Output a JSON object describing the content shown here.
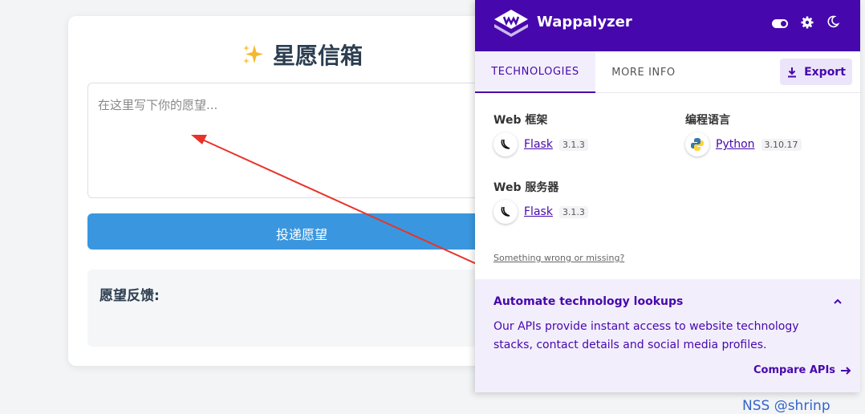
{
  "wish_page": {
    "title": "星愿信箱",
    "title_icon": "sparkles-icon",
    "textarea_placeholder": "在这里写下你的愿望...",
    "submit_label": "投递愿望",
    "feedback_title": "愿望反馈:"
  },
  "wappalyzer": {
    "brand": "Wappalyzer",
    "header_color": "#4608ad",
    "tabs": [
      {
        "label": "TECHNOLOGIES",
        "active": true
      },
      {
        "label": "MORE INFO",
        "active": false
      }
    ],
    "export_label": "Export",
    "categories": [
      {
        "title": "Web 框架",
        "tech": {
          "name": "Flask",
          "version": "3.1.3",
          "icon": "flask-icon"
        }
      },
      {
        "title": "编程语言",
        "tech": {
          "name": "Python",
          "version": "3.10.17",
          "icon": "python-icon"
        }
      },
      {
        "title": "Web 服务器",
        "tech": {
          "name": "Flask",
          "version": "3.1.3",
          "icon": "flask-icon"
        }
      }
    ],
    "something_wrong": "Something wrong or missing?",
    "promo": {
      "title": "Automate technology lookups",
      "text": "Our APIs provide instant access to website technology stacks, contact details and social media profiles.",
      "link": "Compare APIs"
    }
  },
  "watermark": "NSS @shrinp",
  "colors": {
    "accent": "#4608ad",
    "button": "#3a97df",
    "arrow": "#e8332a"
  }
}
